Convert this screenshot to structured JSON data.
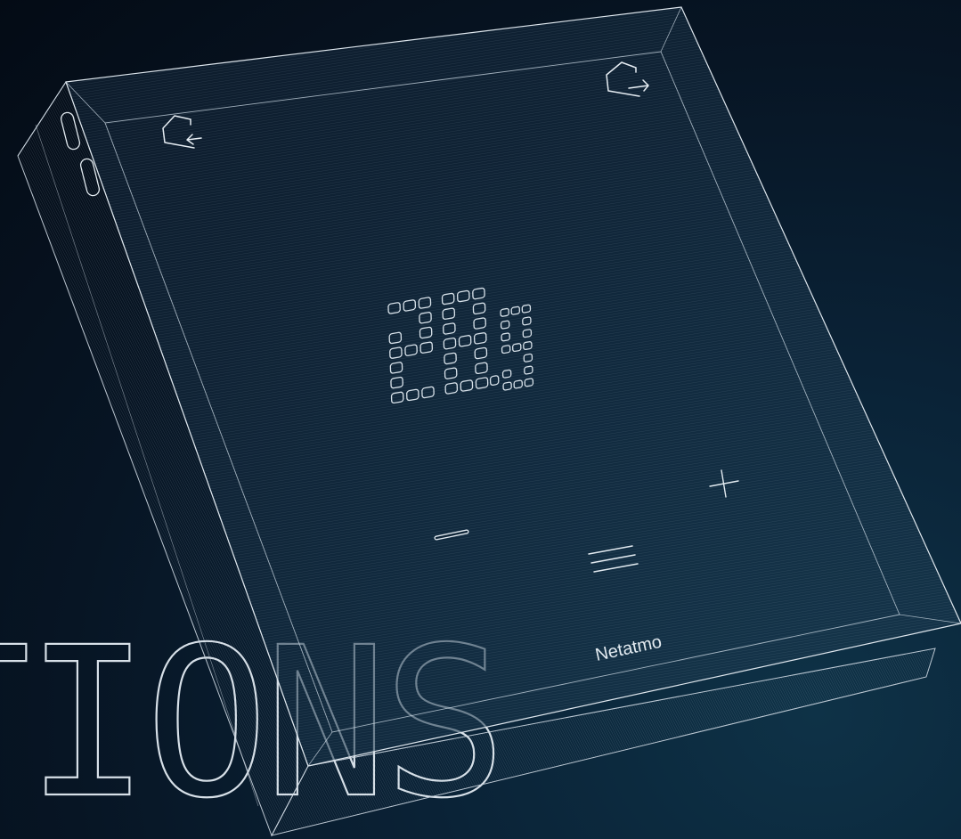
{
  "headline": "TIONS",
  "brand": "Netatmo",
  "display": {
    "digits": [
      "2",
      "0",
      "."
    ],
    "decimal": "5"
  },
  "controls": {
    "minus": "−",
    "plus": "+",
    "menu": "≡"
  },
  "colors": {
    "background_dark": "#040b15",
    "background_light": "#0e3247",
    "line": "#c9d6e2"
  }
}
